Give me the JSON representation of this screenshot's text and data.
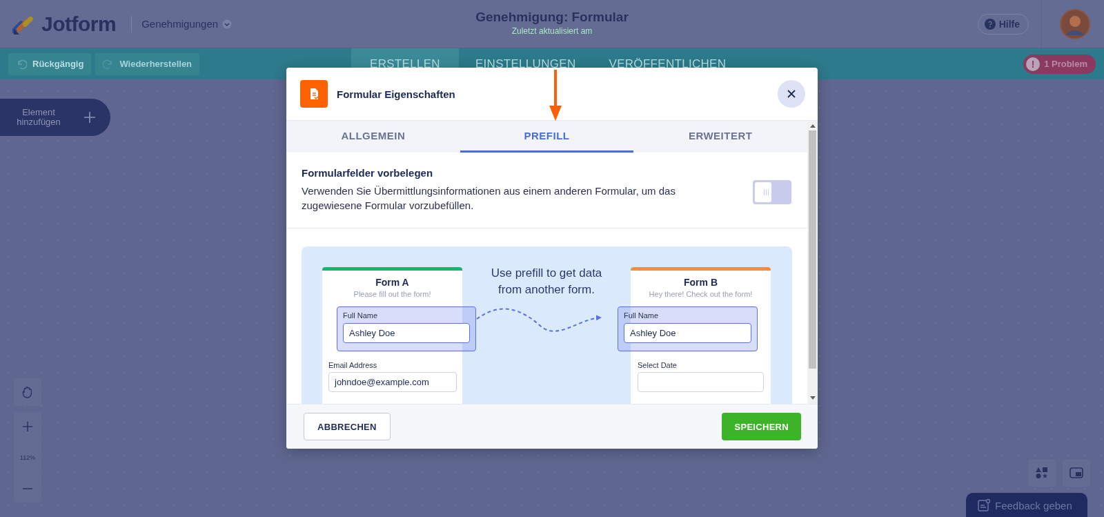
{
  "header": {
    "logo": "Jotform",
    "breadcrumb": "Genehmigungen",
    "title": "Genehmigung: Formular",
    "subtitle": "Zuletzt aktualisiert am",
    "help": "Hilfe"
  },
  "toolbar": {
    "undo": "Rückgängig",
    "redo": "Wiederherstellen",
    "tabs": [
      {
        "label": "ERSTELLEN",
        "selected": true
      },
      {
        "label": "EINSTELLUNGEN",
        "selected": false
      },
      {
        "label": "VERÖFFENTLICHEN",
        "selected": false
      }
    ],
    "problem_icon": "!",
    "problem": "1 Problem"
  },
  "add_element": "Element hinzufügen",
  "zoom_level": "112%",
  "feedback": "Feedback geben",
  "dialog": {
    "title": "Formular Eigenschaften",
    "tabs": [
      {
        "label": "ALLGEMEIN",
        "selected": false
      },
      {
        "label": "PREFILL",
        "selected": true
      },
      {
        "label": "ERWEITERT",
        "selected": false
      }
    ],
    "setting": {
      "title": "Formularfelder vorbelegen",
      "description": "Verwenden Sie Übermittlungsinformationen aus einem anderen Formular, um das zugewiesene Formular vorzubefüllen.",
      "on": false
    },
    "illustration": {
      "caption": "Use prefill to get data from another form.",
      "forms": [
        {
          "title": "Form A",
          "subtitle": "Please fill out the form!",
          "color": "#12b76a",
          "fields": [
            {
              "label": "Full Name",
              "value": "Ashley Doe",
              "highlighted": true
            },
            {
              "label": "Email Address",
              "value": "johndoe@example.com",
              "highlighted": false
            }
          ]
        },
        {
          "title": "Form B",
          "subtitle": "Hey there! Check out the form!",
          "color": "#ff8a3d",
          "fields": [
            {
              "label": "Full Name",
              "value": "Ashley Doe",
              "highlighted": true
            },
            {
              "label": "Select Date",
              "highlighted": false
            }
          ]
        }
      ]
    },
    "cancel": "ABBRECHEN",
    "save": "SPEICHERN"
  }
}
